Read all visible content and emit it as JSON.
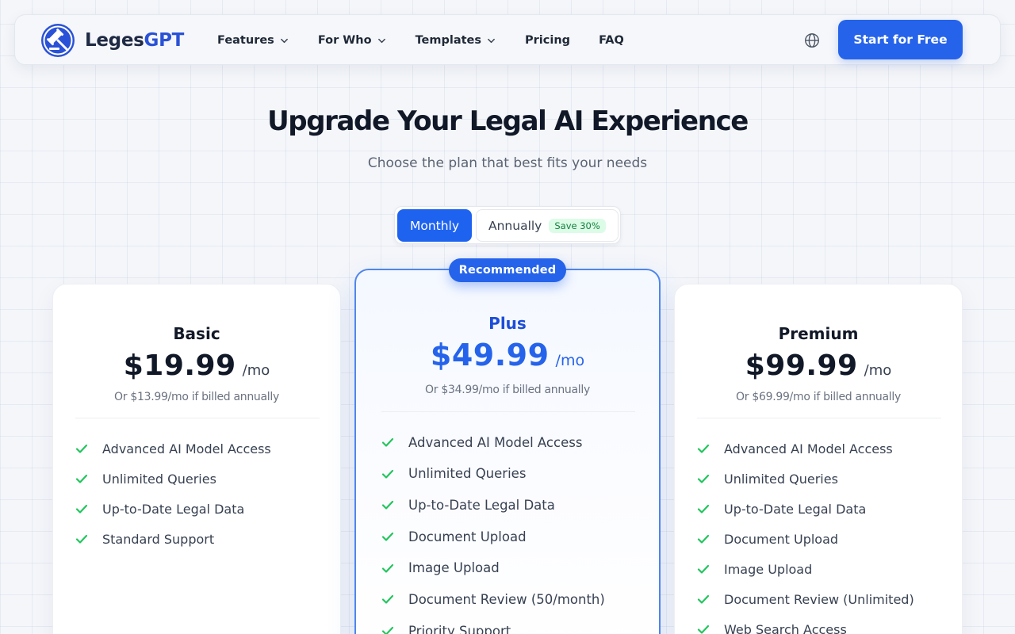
{
  "nav": {
    "logo_part1": "Leges",
    "logo_part2": "GPT",
    "items": [
      {
        "label": "Features",
        "has_dropdown": true
      },
      {
        "label": "For Who",
        "has_dropdown": true
      },
      {
        "label": "Templates",
        "has_dropdown": true
      },
      {
        "label": "Pricing",
        "has_dropdown": false
      },
      {
        "label": "FAQ",
        "has_dropdown": false
      }
    ],
    "language_icon": "globe-icon",
    "cta_label": "Start for Free"
  },
  "hero": {
    "title": "Upgrade Your Legal AI Experience",
    "subtitle": "Choose the plan that best fits your needs"
  },
  "billing_toggle": {
    "monthly_label": "Monthly",
    "annually_label": "Annually",
    "save_badge": "Save 30%",
    "selected": "Monthly"
  },
  "plans": [
    {
      "name": "Basic",
      "price": "$19.99",
      "period": "/mo",
      "annual_note": "Or $13.99/mo if billed annually",
      "features": [
        "Advanced AI Model Access",
        "Unlimited Queries",
        "Up-to-Date Legal Data",
        "Standard Support"
      ]
    },
    {
      "name": "Plus",
      "badge": "Recommended",
      "price": "$49.99",
      "period": "/mo",
      "annual_note": "Or $34.99/mo if billed annually",
      "features": [
        "Advanced AI Model Access",
        "Unlimited Queries",
        "Up-to-Date Legal Data",
        "Document Upload",
        "Image Upload",
        "Document Review (50/month)",
        "Priority Support"
      ]
    },
    {
      "name": "Premium",
      "price": "$99.99",
      "period": "/mo",
      "annual_note": "Or $69.99/mo if billed annually",
      "features": [
        "Advanced AI Model Access",
        "Unlimited Queries",
        "Up-to-Date Legal Data",
        "Document Upload",
        "Image Upload",
        "Document Review (Unlimited)",
        "Web Search Access"
      ]
    }
  ],
  "colors": {
    "primary": "#2563eb",
    "check": "#22c55e",
    "save_badge_bg": "#dcfce7",
    "save_badge_text": "#15803d"
  }
}
